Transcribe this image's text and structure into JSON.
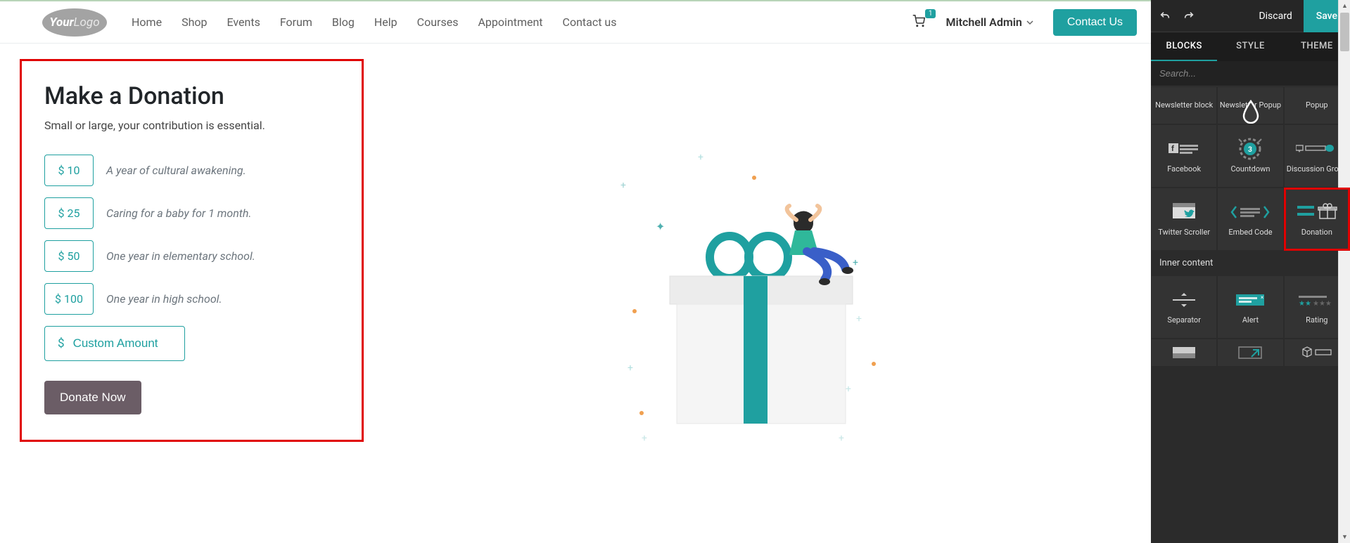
{
  "header": {
    "logo_text_1": "Your",
    "logo_text_2": "Logo",
    "nav": [
      "Home",
      "Shop",
      "Events",
      "Forum",
      "Blog",
      "Help",
      "Courses",
      "Appointment",
      "Contact us"
    ],
    "cart_count": "1",
    "user_name": "Mitchell Admin",
    "contact_btn": "Contact Us"
  },
  "donation": {
    "title": "Make a Donation",
    "subtitle": "Small or large, your contribution is essential.",
    "amounts": [
      {
        "value": "$ 10",
        "desc": "A year of cultural awakening."
      },
      {
        "value": "$ 25",
        "desc": "Caring for a baby for 1 month."
      },
      {
        "value": "$ 50",
        "desc": "One year in elementary school."
      },
      {
        "value": "$ 100",
        "desc": "One year in high school."
      }
    ],
    "custom_prefix": "$",
    "custom_placeholder": "Custom Amount",
    "donate_btn": "Donate Now"
  },
  "editor": {
    "discard": "Discard",
    "save": "Save",
    "tabs": {
      "blocks": "BLOCKS",
      "style": "STYLE",
      "theme": "THEME"
    },
    "search_placeholder": "Search...",
    "blocks_row1": [
      "Newsletter block",
      "Newsletter Popup",
      "Popup"
    ],
    "blocks_row2": [
      "Facebook",
      "Countdown",
      "Discussion Group"
    ],
    "blocks_row3": [
      "Twitter Scroller",
      "Embed Code",
      "Donation"
    ],
    "inner_label": "Inner content",
    "blocks_row4": [
      "Separator",
      "Alert",
      "Rating"
    ]
  }
}
